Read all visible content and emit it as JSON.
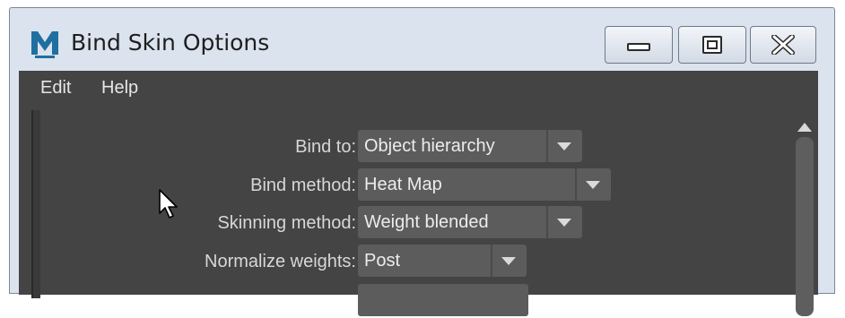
{
  "window": {
    "title": "Bind Skin Options",
    "app_icon": "maya-logo-icon",
    "controls": [
      "minimize-icon",
      "maximize-icon",
      "close-icon"
    ]
  },
  "menu": {
    "edit": "Edit",
    "help": "Help"
  },
  "options": [
    {
      "label": "Bind to:",
      "value": "Object hierarchy"
    },
    {
      "label": "Bind method:",
      "value": "Heat Map"
    },
    {
      "label": "Skinning method:",
      "value": "Weight blended"
    },
    {
      "label": "Normalize weights:",
      "value": "Post"
    }
  ],
  "colors": {
    "titlebar": "#dbe3ee",
    "panel": "#444444",
    "dropdown": "#5c5c5c",
    "text": "#d7d7d7"
  }
}
